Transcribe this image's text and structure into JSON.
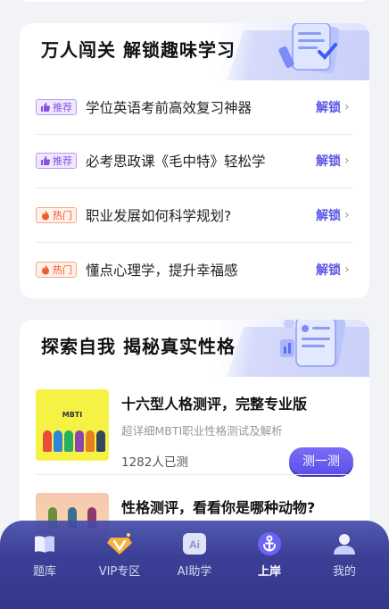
{
  "section1": {
    "title": "万人闯关 解锁趣味学习",
    "items": [
      {
        "tag": "推荐",
        "tag_type": "rec",
        "text": "学位英语考前高效复习神器",
        "action": "解锁"
      },
      {
        "tag": "推荐",
        "tag_type": "rec",
        "text": "必考思政课《毛中特》轻松学",
        "action": "解锁"
      },
      {
        "tag": "热门",
        "tag_type": "hot",
        "text": "职业发展如何科学规划?",
        "action": "解锁"
      },
      {
        "tag": "热门",
        "tag_type": "hot",
        "text": "懂点心理学，提升幸福感",
        "action": "解锁"
      }
    ]
  },
  "section2": {
    "title": "探索自我 揭秘真实性格",
    "tests": [
      {
        "thumb_text": "MBTI",
        "title": "十六型人格测评，完整专业版",
        "subtitle": "超详细MBTI职业性格测试及解析",
        "count": "1282人已测",
        "button": "测一测"
      },
      {
        "title": "性格测评，看看你是哪种动物?"
      }
    ]
  },
  "tabbar": {
    "tabs": [
      {
        "label": "题库",
        "icon": "book-icon"
      },
      {
        "label": "VIP专区",
        "icon": "vip-diamond-icon"
      },
      {
        "label": "AI助学",
        "icon": "ai-icon"
      },
      {
        "label": "上岸",
        "icon": "anchor-icon",
        "active": true
      },
      {
        "label": "我的",
        "icon": "profile-icon"
      }
    ]
  },
  "colors": {
    "accent": "#5b56e8",
    "hot": "#f25a2a",
    "rec": "#8a4fe6",
    "tabbar": "#3b3f96"
  }
}
